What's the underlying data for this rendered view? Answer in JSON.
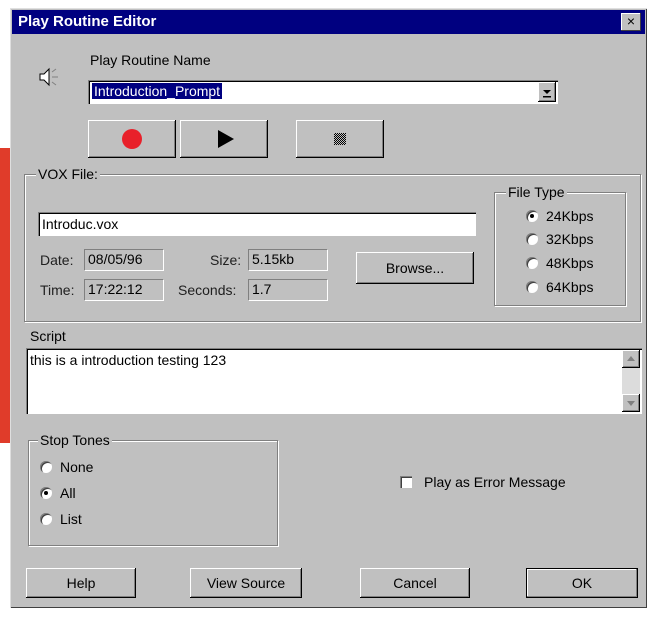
{
  "window": {
    "title": "Play Routine Editor",
    "close_glyph": "×"
  },
  "routine": {
    "name_label": "Play Routine Name",
    "name_value": "Introduction_Prompt",
    "speaker_icon": "speaker-icon"
  },
  "transport": {
    "record_icon": "record-icon",
    "play_icon": "play-icon",
    "stop_icon": "stop-icon"
  },
  "vox": {
    "legend": "VOX File:",
    "file_value": "Introduc.vox",
    "date_label": "Date:",
    "date_value": "08/05/96",
    "size_label": "Size:",
    "size_value": "5.15kb",
    "time_label": "Time:",
    "time_value": "17:22:12",
    "seconds_label": "Seconds:",
    "seconds_value": "1.7",
    "browse_label": "Browse..."
  },
  "file_type": {
    "legend": "File Type",
    "options": [
      "24Kbps",
      "32Kbps",
      "48Kbps",
      "64Kbps"
    ],
    "selected": "24Kbps"
  },
  "script": {
    "label": "Script",
    "value": "this is a introduction  testing 123"
  },
  "stop_tones": {
    "legend": "Stop Tones",
    "options": [
      "None",
      "All",
      "List"
    ],
    "selected": "All"
  },
  "error_option": {
    "label": "Play as Error Message",
    "checked": false
  },
  "buttons": {
    "help": "Help",
    "view_source": "View Source",
    "cancel": "Cancel",
    "ok": "OK"
  },
  "colors": {
    "title_bar": "#000080",
    "face": "#c0c0c0",
    "record": "#e8202a",
    "selection": "#000080",
    "accent_bar": "#e03c2a"
  }
}
